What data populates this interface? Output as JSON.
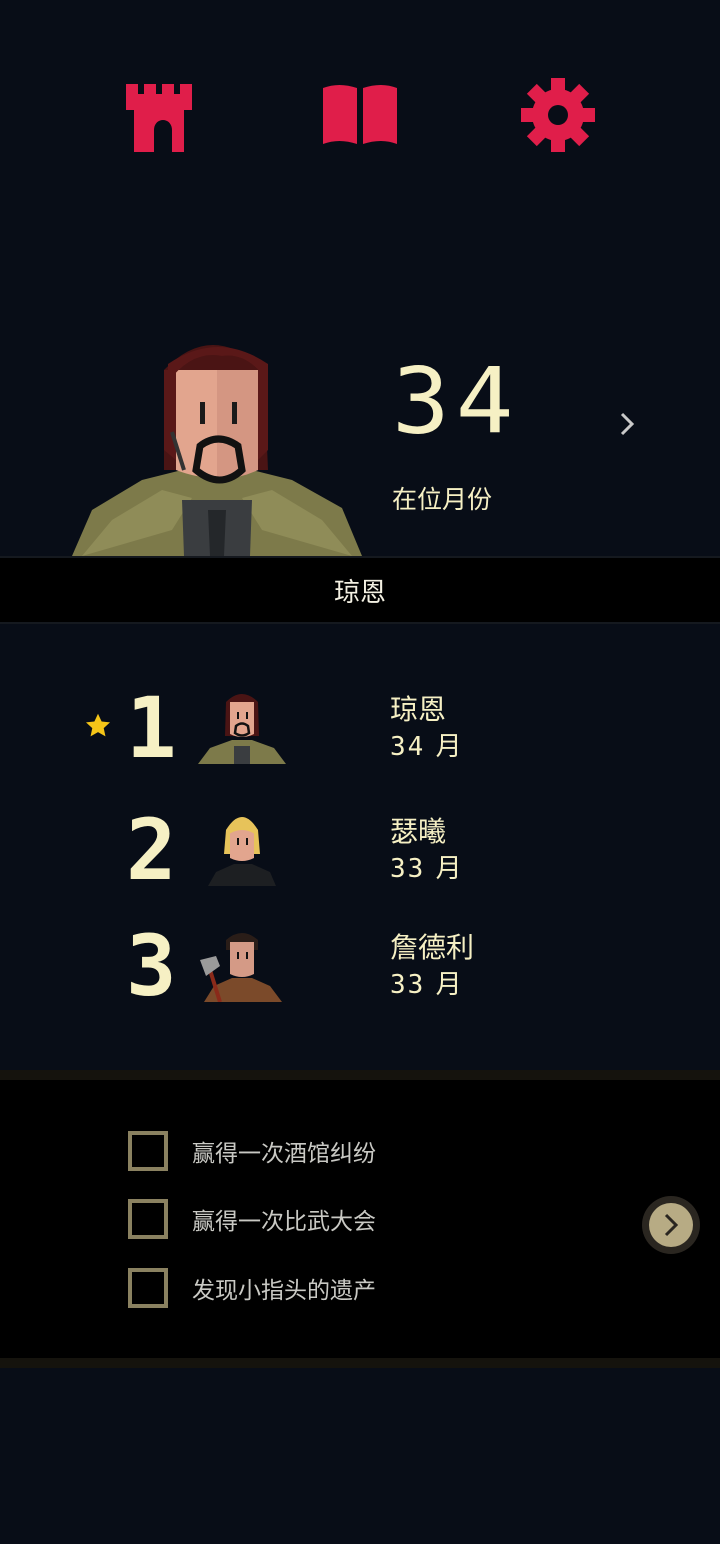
{
  "top_nav": {
    "icons": [
      "castle-icon",
      "book-icon",
      "gear-icon"
    ],
    "accent_color": "#e01e4a"
  },
  "hero": {
    "reign_months": "34",
    "reign_label": "在位月份",
    "ruler_name": "琼恩"
  },
  "leaderboard": {
    "rows": [
      {
        "rank": "1",
        "name": "琼恩",
        "months": "34",
        "unit": "月",
        "current": true
      },
      {
        "rank": "2",
        "name": "瑟曦",
        "months": "33",
        "unit": "月",
        "current": false
      },
      {
        "rank": "3",
        "name": "詹德利",
        "months": "33",
        "unit": "月",
        "current": false
      }
    ]
  },
  "goals": {
    "items": [
      {
        "label": "赢得一次酒馆纠纷",
        "checked": false
      },
      {
        "label": "赢得一次比武大会",
        "checked": false
      },
      {
        "label": "发现小指头的遗产",
        "checked": false
      }
    ]
  },
  "colors": {
    "background": "#080d17",
    "text_cream": "#f6f0c4",
    "checkbox_border": "#8a8160",
    "star": "#f5c518"
  }
}
